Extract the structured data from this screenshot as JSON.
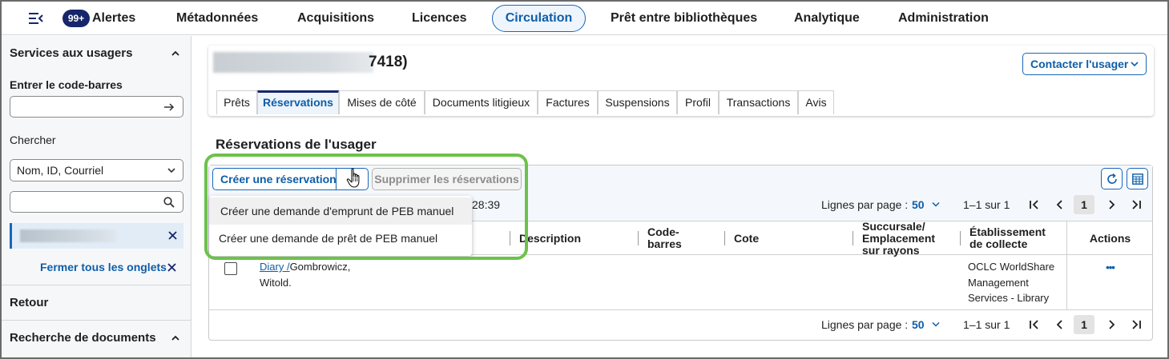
{
  "nav": {
    "badge": "99+",
    "items": [
      {
        "label": "Alertes"
      },
      {
        "label": "Métadonnées"
      },
      {
        "label": "Acquisitions"
      },
      {
        "label": "Licences"
      },
      {
        "label": "Circulation"
      },
      {
        "label": "Prêt entre bibliothèques"
      },
      {
        "label": "Analytique"
      },
      {
        "label": "Administration"
      }
    ],
    "active": "Circulation"
  },
  "sidebar": {
    "section1_title": "Services aux usagers",
    "barcode_label": "Entrer le code-barres",
    "search_label": "Chercher",
    "search_select": "Nom, ID, Courriel",
    "close_all": "Fermer tous les onglets",
    "retour": "Retour",
    "section2_title": "Recherche de documents"
  },
  "patron": {
    "name_suffix": "7418)",
    "contact_button": "Contacter l'usager",
    "tabs": [
      "Prêts",
      "Réservations",
      "Mises de côté",
      "Documents litigieux",
      "Factures",
      "Suspensions",
      "Profil",
      "Transactions",
      "Avis"
    ],
    "active_tab": "Réservations"
  },
  "holds": {
    "title": "Réservations de l'usager",
    "create_button": "Créer une réservation",
    "delete_button": "Supprimer les réservations",
    "time_fragment": "28:39",
    "pager": {
      "rows_label": "Lignes par page :",
      "rows_value": "50",
      "range": "1–1 sur 1",
      "page": "1"
    },
    "columns": {
      "description": "Description",
      "barcode": "Code-barres",
      "call_number": "Cote",
      "branch": "Succursale/ Emplacement sur rayons",
      "pickup": "Établissement de collecte",
      "actions": "Actions"
    },
    "row": {
      "title_link": "Diary /",
      "title_rest": "Gombrowicz, Witold.",
      "pickup": "OCLC WorldShare Management Services - Library",
      "actions_menu": "•••"
    },
    "dropdown": [
      "Créer une demande d'emprunt de PEB manuel",
      "Créer une demande de prêt de PEB manuel"
    ]
  },
  "colors": {
    "brand_dark": "#17266a",
    "accent": "#0e5ea8",
    "highlight": "#6cc24a"
  }
}
